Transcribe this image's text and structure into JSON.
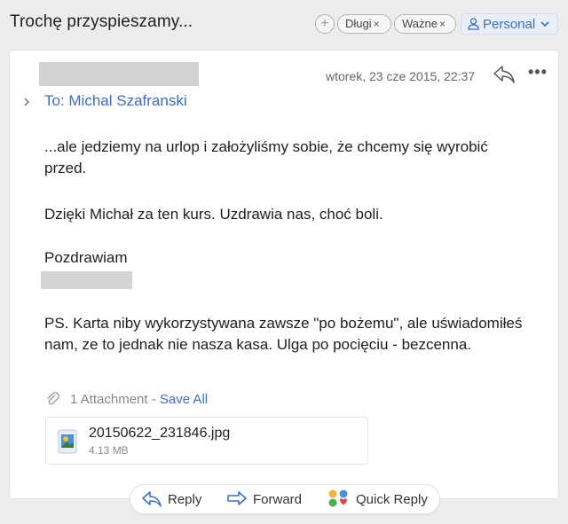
{
  "header": {
    "subject": "Trochę przyspieszamy...",
    "add_tag_symbol": "+",
    "tags": [
      {
        "label": "Długi",
        "remove": "×"
      },
      {
        "label": "Ważne",
        "remove": "×"
      }
    ],
    "folder": {
      "label": "Personal",
      "icon": "person-icon",
      "chevron": "chevron-down-icon"
    }
  },
  "message": {
    "date": "wtorek, 23 cze 2015, 22:37",
    "more_symbol": "•••",
    "to": "To: Michal Szafranski",
    "paragraphs": [
      "...ale jedziemy na urlop i założyliśmy sobie, że chcemy się wyrobić przed.",
      "Dzięki Michał za ten kurs. Uzdrawia nas, choć boli.",
      "Pozdrawiam",
      "PS. Karta niby wykorzystywana zawsze \"po bożemu\", ale uświadomiłeś nam, ze to jednak nie nasza kasa. Ulga po pocięciu - bezcenna."
    ]
  },
  "attachments": {
    "count_label": "1 Attachment",
    "separator": " - ",
    "save_all": "Save All",
    "items": [
      {
        "name": "20150622_231846.jpg",
        "size": "4.13 MB"
      }
    ]
  },
  "actions": {
    "reply": "Reply",
    "forward": "Forward",
    "quick_reply": "Quick Reply"
  },
  "colors": {
    "accent": "#3a6fc9",
    "background": "#ececec",
    "card": "#ffffff",
    "redaction": "#d2d2d2"
  }
}
